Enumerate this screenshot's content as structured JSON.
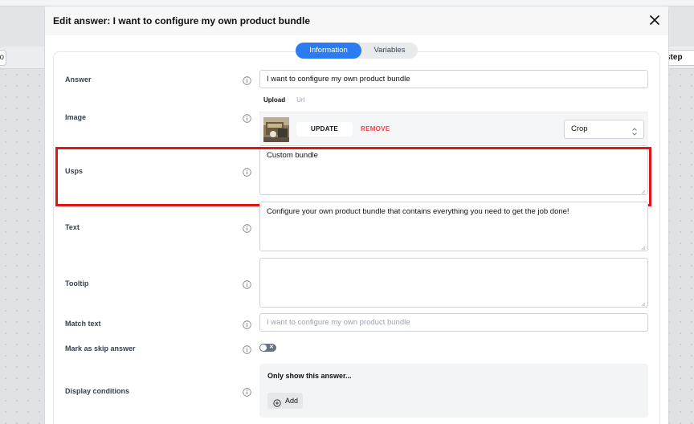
{
  "background": {
    "left_button_label": "o",
    "step_button_label": "step"
  },
  "modal": {
    "title": "Edit answer: I want to configure my own product bundle",
    "close_icon": "close-icon"
  },
  "tabs": [
    {
      "label": "Information",
      "active": true
    },
    {
      "label": "Variables",
      "active": false
    }
  ],
  "fields": {
    "answer": {
      "label": "Answer",
      "value": "I want to configure my own product bundle"
    },
    "image": {
      "label": "Image",
      "upload_tab": "Upload",
      "url_tab": "Url",
      "update_label": "UPDATE",
      "remove_label": "REMOVE",
      "crop_value": "Crop"
    },
    "usps": {
      "label": "Usps",
      "value": "Custom bundle"
    },
    "text": {
      "label": "Text",
      "value": "Configure your own product bundle that contains everything you need to get the job done!"
    },
    "tooltip": {
      "label": "Tooltip",
      "value": ""
    },
    "match_text": {
      "label": "Match text",
      "placeholder": "I want to configure my own product bundle"
    },
    "skip_answer": {
      "label": "Mark as skip answer",
      "enabled": false
    },
    "display_conditions": {
      "label": "Display conditions",
      "panel_title": "Only show this answer...",
      "add_label": "Add"
    }
  },
  "colors": {
    "accent": "#2b7cf2",
    "remove": "#ef4444",
    "highlight": "#e01515"
  }
}
